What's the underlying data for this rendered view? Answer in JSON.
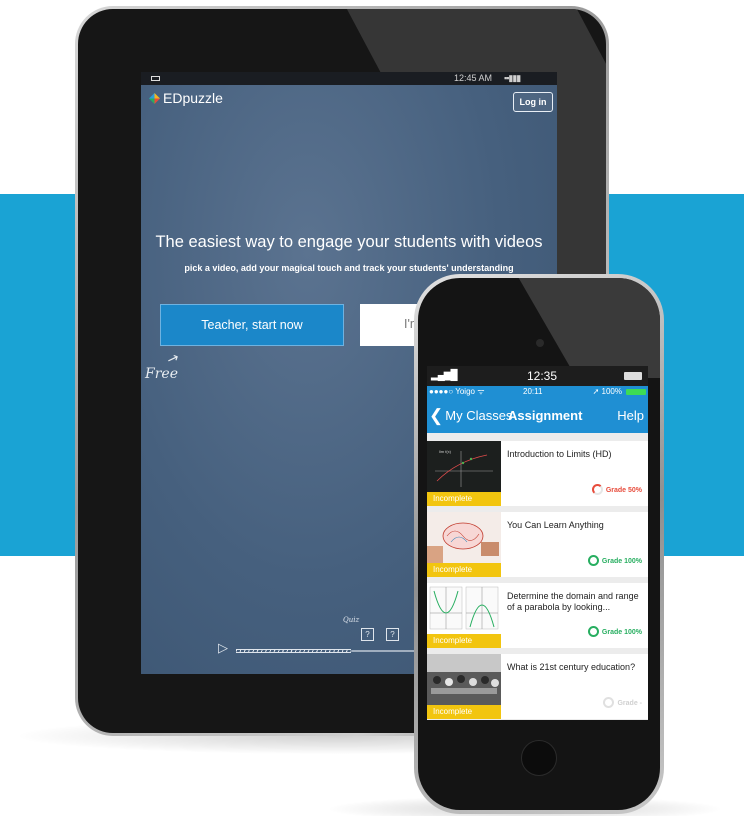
{
  "tablet": {
    "status": {
      "time": "12:45 AM",
      "signal": "▪▪▮▮▮"
    },
    "brand": "EDpuzzle",
    "login_label": "Log in",
    "headline": "The easiest way to engage your students with videos",
    "subheadline": "pick a video, add your magical touch and track your students' understanding",
    "teacher_button": "Teacher, start now",
    "student_button_partial": "I'm",
    "free_note": "Free",
    "quiz_note": "Quiz"
  },
  "phone": {
    "status1": {
      "signal": "▂▄▆█",
      "time": "12:35"
    },
    "status2": {
      "carrier": "●●●●○ Yoigo ᯤ",
      "time": "20:11",
      "battery": "➚ 100%"
    },
    "nav": {
      "back_label": "My Classes",
      "title": "Assignment",
      "help_label": "Help"
    },
    "assignments": [
      {
        "title": "Introduction to Limits (HD)",
        "status": "Incomplete",
        "grade": "Grade 50%",
        "grade_color": "#e74c3c"
      },
      {
        "title": "You Can Learn Anything",
        "status": "Incomplete",
        "grade": "Grade 100%",
        "grade_color": "#27ae60"
      },
      {
        "title": "Determine the domain and range of a parabola by looking...",
        "status": "Incomplete",
        "grade": "Grade 100%",
        "grade_color": "#27ae60"
      },
      {
        "title": "What is 21st century education?",
        "status": "Incomplete",
        "grade": "Grade -",
        "grade_color": "#d0d0d0"
      }
    ]
  },
  "colors": {
    "accent_band": "#1aa3d4",
    "button_blue": "#1b87c9",
    "incomplete_yellow": "#f2c50f"
  }
}
